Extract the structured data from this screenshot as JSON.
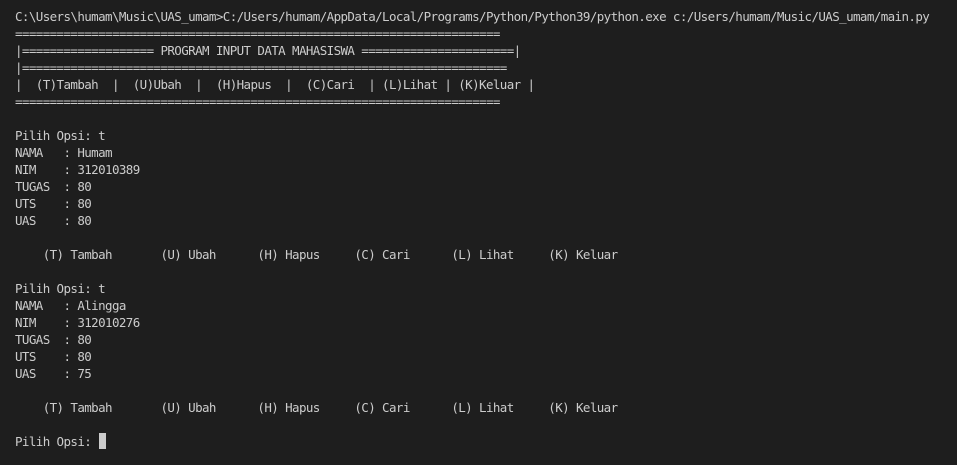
{
  "terminal": {
    "lines": [
      "C:\\Users\\humam\\Music\\UAS_umam>C:/Users/humam/AppData/Local/Programs/Python/Python39/python.exe c:/Users/humam/Music/UAS_umam/main.py",
      "======================================================================",
      "|=================== PROGRAM INPUT DATA MAHASISWA ======================|",
      "|======================================================================",
      "|  (T)Tambah  |  (U)Ubah  |  (H)Hapus  |  (C)Cari  | (L)Lihat | (K)Keluar |",
      "======================================================================",
      "",
      "Pilih Opsi: t",
      "NAMA   : Humam",
      "NIM    : 312010389",
      "TUGAS  : 80",
      "UTS    : 80",
      "UAS    : 80",
      "",
      "    (T) Tambah       (U) Ubah      (H) Hapus     (C) Cari      (L) Lihat     (K) Keluar",
      "",
      "Pilih Opsi: t",
      "NAMA   : Alingga",
      "NIM    : 312010276",
      "TUGAS  : 80",
      "UTS    : 80",
      "UAS    : 75",
      "",
      "    (T) Tambah       (U) Ubah      (H) Hapus     (C) Cari      (L) Lihat     (K) Keluar",
      "",
      "Pilih Opsi: "
    ]
  },
  "colors": {
    "background": "#1e1e1e",
    "text": "#cccccc"
  }
}
